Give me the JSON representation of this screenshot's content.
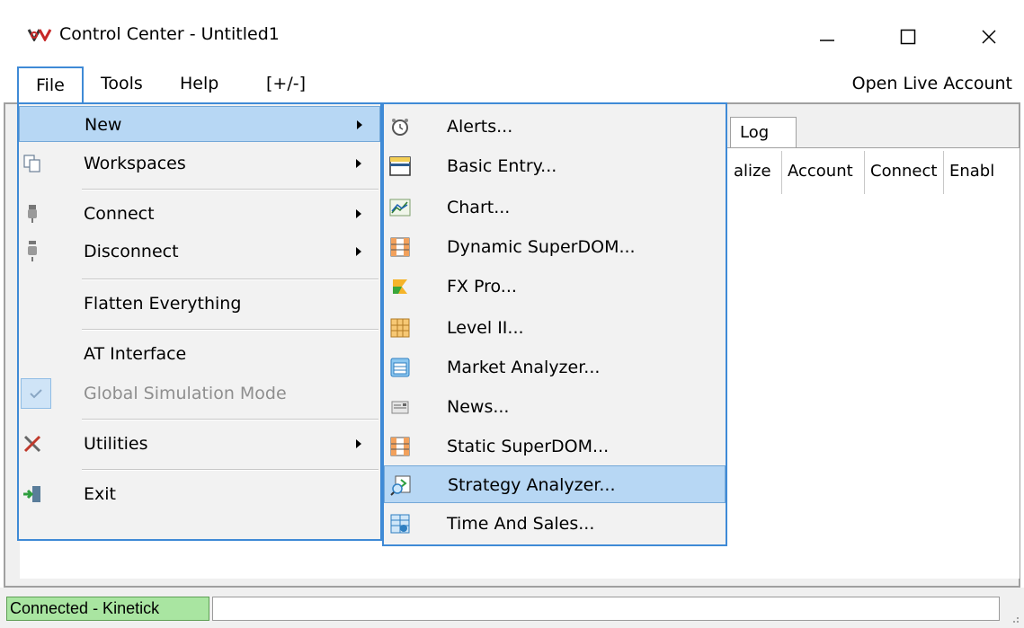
{
  "window": {
    "title": "Control Center - Untitled1",
    "minimize_icon": "minimize-icon",
    "maximize_icon": "maximize-icon",
    "close_icon": "close-icon"
  },
  "menubar": {
    "file": "File",
    "tools": "Tools",
    "help": "Help",
    "toggle": "[+/-]",
    "open_live_account": "Open Live Account"
  },
  "tabs": {
    "log": "Log"
  },
  "columns": [
    "alize",
    "Account",
    "Connect",
    "Enabl"
  ],
  "file_menu": {
    "items": [
      {
        "label": "New",
        "icon": "none",
        "submenu": true
      },
      {
        "label": "Workspaces",
        "icon": "workspaces-icon",
        "submenu": true
      },
      {
        "label": "Connect",
        "icon": "connect-plug-icon",
        "submenu": true
      },
      {
        "label": "Disconnect",
        "icon": "disconnect-plug-icon",
        "submenu": true
      },
      {
        "label": "Flatten Everything"
      },
      {
        "label": "AT Interface"
      },
      {
        "label": "Global Simulation Mode",
        "disabled": true,
        "checked": true
      },
      {
        "label": "Utilities",
        "icon": "utilities-tools-icon",
        "submenu": true
      },
      {
        "label": "Exit",
        "icon": "exit-door-icon"
      }
    ]
  },
  "new_menu": {
    "items": [
      {
        "label": "Alerts...",
        "icon": "alarm-clock-icon"
      },
      {
        "label": "Basic Entry...",
        "icon": "basic-entry-window-icon"
      },
      {
        "label": "Chart...",
        "icon": "chart-icon"
      },
      {
        "label": "Dynamic SuperDOM...",
        "icon": "superdom-grid-icon"
      },
      {
        "label": "FX Pro...",
        "icon": "fx-pro-icon"
      },
      {
        "label": "Level II...",
        "icon": "level-two-grid-icon"
      },
      {
        "label": "Market Analyzer...",
        "icon": "market-analyzer-icon"
      },
      {
        "label": "News...",
        "icon": "news-icon"
      },
      {
        "label": "Static SuperDOM...",
        "icon": "static-superdom-icon"
      },
      {
        "label": "Strategy Analyzer...",
        "icon": "strategy-analyzer-icon",
        "highlighted": true
      },
      {
        "label": "Time And Sales...",
        "icon": "time-and-sales-icon"
      }
    ]
  },
  "status": {
    "connection": "Connected - Kinetick",
    "connection_color": "#a9e5a1"
  },
  "colors": {
    "menu_border": "#3f8ad6",
    "highlight": "#b7d7f4",
    "menu_bg": "#f2f2f2"
  }
}
